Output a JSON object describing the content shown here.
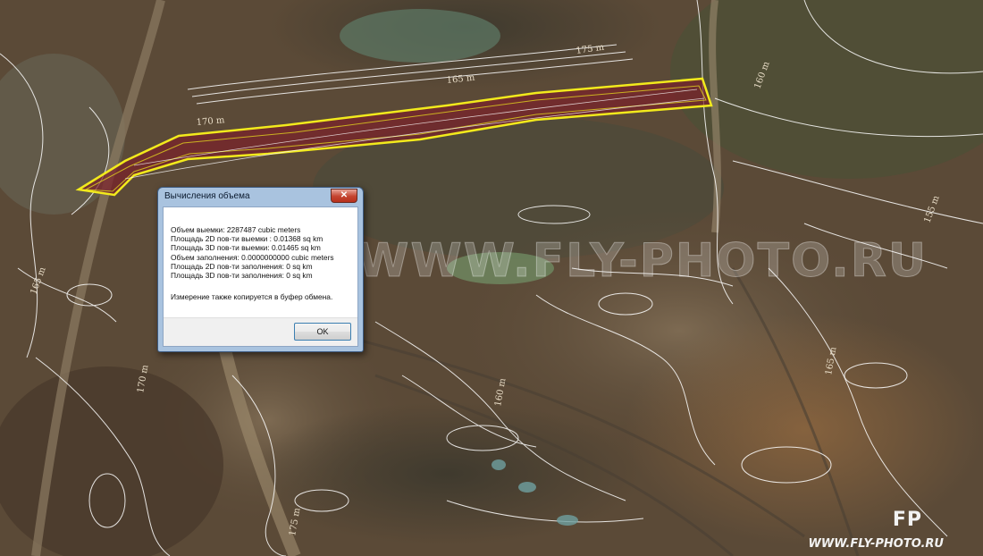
{
  "map": {
    "contour_labels": [
      "165 m",
      "160 m",
      "170 m",
      "175 m",
      "155 m",
      "165 m",
      "170 m",
      "160 m",
      "175 m",
      "165 m"
    ],
    "colors": {
      "selection_outline": "#f2ea1c",
      "selection_fill": "#7a1f2a",
      "contour": "#ffffff"
    }
  },
  "watermark": "WWW.FLY-PHOTO.RU",
  "brand": {
    "logo": "FP",
    "url": "WWW.FLY-PHOTO.RU"
  },
  "dialog": {
    "title": "Вычисления объема",
    "close_label": "✕",
    "lines": [
      "Объем выемки: 2287487 cubic meters",
      "Площадь 2D пов-ти выемки : 0.01368 sq km",
      "Площадь 3D пов-ти выемки: 0.01465 sq km",
      "Объем заполнения: 0.0000000000 cubic meters",
      "Площадь 2D пов-ти заполнения: 0 sq km",
      "Площадь 3D пов-ти заполнения: 0 sq km"
    ],
    "note": "Измерение также копируется в буфер обмена.",
    "ok_label": "OK"
  }
}
